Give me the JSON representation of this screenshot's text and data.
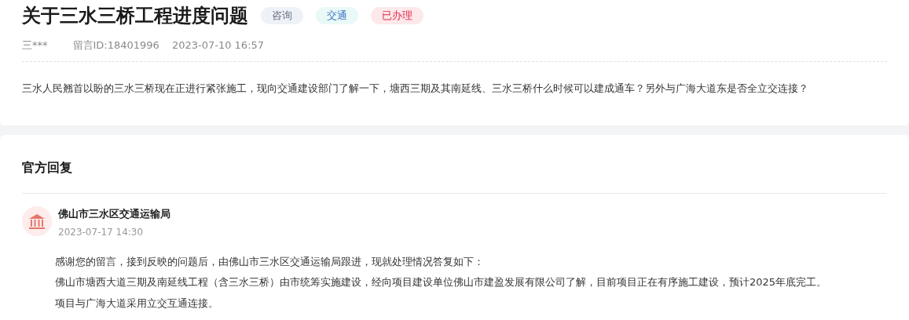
{
  "question": {
    "title": "关于三水三桥工程进度问题",
    "tags": [
      {
        "label": "咨询",
        "kind": "type"
      },
      {
        "label": "交通",
        "kind": "category"
      },
      {
        "label": "已办理",
        "kind": "status"
      }
    ],
    "author": "三***",
    "message_id": "留言ID:18401996",
    "time": "2023-07-10 16:57",
    "content": "三水人民翘首以盼的三水三桥现在正进行紧张施工，现向交通建设部门了解一下，塘西三期及其南延线、三水三桥什么时候可以建成通车？另外与广海大道东是否全立交连接？"
  },
  "reply": {
    "heading": "官方回复",
    "department": "佛山市三水区交通运输局",
    "time": "2023-07-17 14:30",
    "paragraphs": [
      "感谢您的留言，接到反映的问题后，由佛山市三水区交通运输局跟进，现就处理情况答复如下：",
      "佛山市塘西大道三期及南延线工程（含三水三桥）由市统筹实施建设，经向项目建设单位佛山市建盈发展有限公司了解，目前项目正在有序施工建设，预计2025年底完工。",
      "项目与广海大道采用立交互通连接。"
    ]
  }
}
